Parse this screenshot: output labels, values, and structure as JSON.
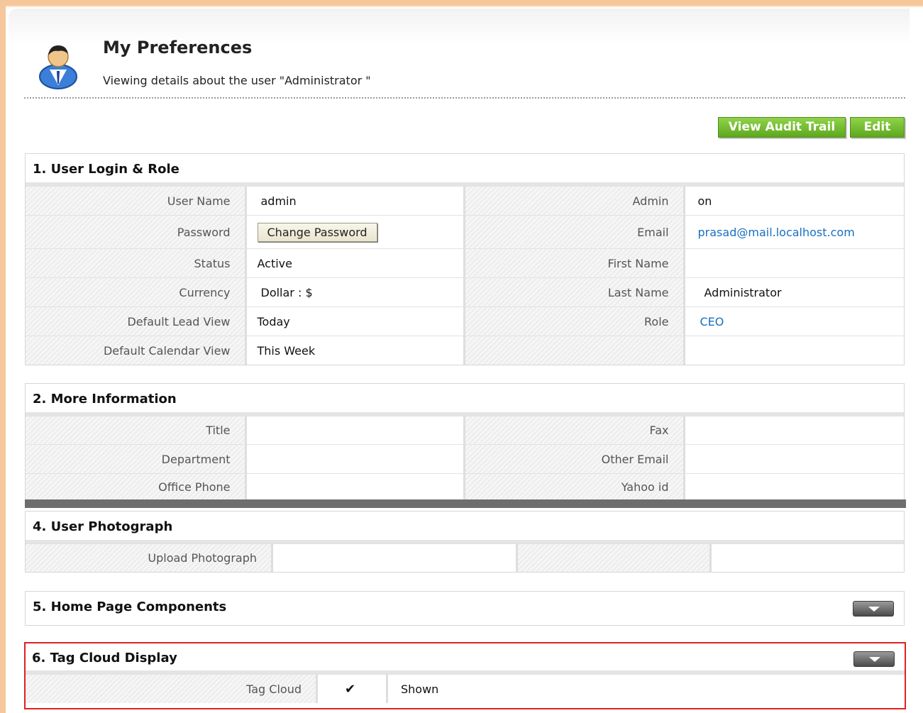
{
  "page": {
    "title": "My Preferences",
    "subtitle": "Viewing details about the user \"Administrator \""
  },
  "avatar_icon": "user-avatar-icon",
  "actions": {
    "audit_label": "View Audit Trail",
    "edit_label": "Edit"
  },
  "section1": {
    "title": "1. User Login & Role",
    "rows": [
      {
        "l1": "User Name",
        "v1": "admin",
        "l2": "Admin",
        "v2": "on"
      },
      {
        "l1": "Password",
        "v1": "Change Password",
        "l2": "Email",
        "v2": "prasad@mail.localhost.com"
      },
      {
        "l1": "Status",
        "v1": "Active",
        "l2": "First Name",
        "v2": ""
      },
      {
        "l1": "Currency",
        "v1": "Dollar : $",
        "l2": "Last Name",
        "v2": "Administrator"
      },
      {
        "l1": "Default Lead View",
        "v1": "Today",
        "l2": "Role",
        "v2": "CEO"
      },
      {
        "l1": "Default Calendar View",
        "v1": "This Week",
        "l2": "",
        "v2": ""
      }
    ]
  },
  "section2": {
    "title": "2. More Information",
    "rows": [
      {
        "l1": "Title",
        "v1": "",
        "l2": "Fax",
        "v2": ""
      },
      {
        "l1": "Department",
        "v1": "",
        "l2": "Other Email",
        "v2": ""
      },
      {
        "l1": "Office Phone",
        "v1": "",
        "l2": "Yahoo id",
        "v2": ""
      }
    ]
  },
  "section4": {
    "title": "4. User Photograph",
    "label": "Upload Photograph"
  },
  "section5": {
    "title": "5. Home Page Components"
  },
  "section6": {
    "title": "6. Tag Cloud Display",
    "label": "Tag Cloud",
    "check": "✔",
    "value": "Shown"
  },
  "colors": {
    "accent_green": "#6cbd28",
    "link_blue": "#1770c0",
    "highlight_red": "#e02020",
    "frame_orange": "#f6c79a"
  }
}
